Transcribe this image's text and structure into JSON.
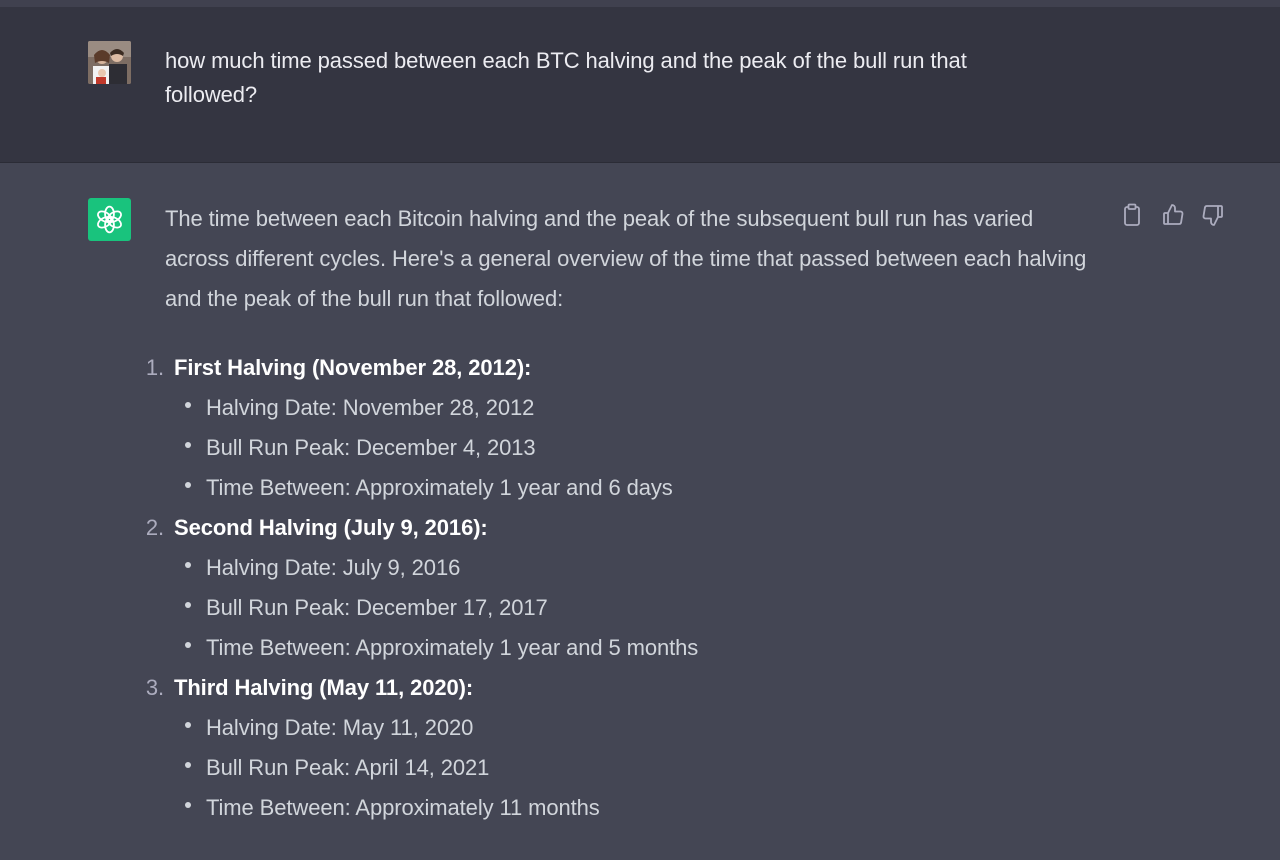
{
  "user": {
    "message": "how much time passed between each BTC halving and the peak of the bull run that followed?"
  },
  "assistant": {
    "intro": "The time between each Bitcoin halving and the peak of the subsequent bull run has varied across different cycles. Here's a general overview of the time that passed between each halving and the peak of the bull run that followed:",
    "sections": [
      {
        "number": "1.",
        "title": "First Halving (November 28, 2012):",
        "bullets": [
          "Halving Date: November 28, 2012",
          "Bull Run Peak: December 4, 2013",
          "Time Between: Approximately 1 year and 6 days"
        ]
      },
      {
        "number": "2.",
        "title": "Second Halving (July 9, 2016):",
        "bullets": [
          "Halving Date: July 9, 2016",
          "Bull Run Peak: December 17, 2017",
          "Time Between: Approximately 1 year and 5 months"
        ]
      },
      {
        "number": "3.",
        "title": "Third Halving (May 11, 2020):",
        "bullets": [
          "Halving Date: May 11, 2020",
          "Bull Run Peak: April 14, 2021",
          "Time Between: Approximately 11 months"
        ]
      }
    ]
  },
  "icons": {
    "copy": "clipboard-icon",
    "like": "thumbs-up-icon",
    "dislike": "thumbs-down-icon",
    "assistant_avatar": "openai-logo-icon"
  },
  "colors": {
    "user_bg": "#343541",
    "assistant_bg": "#444654",
    "brand_green": "#19c37d"
  }
}
